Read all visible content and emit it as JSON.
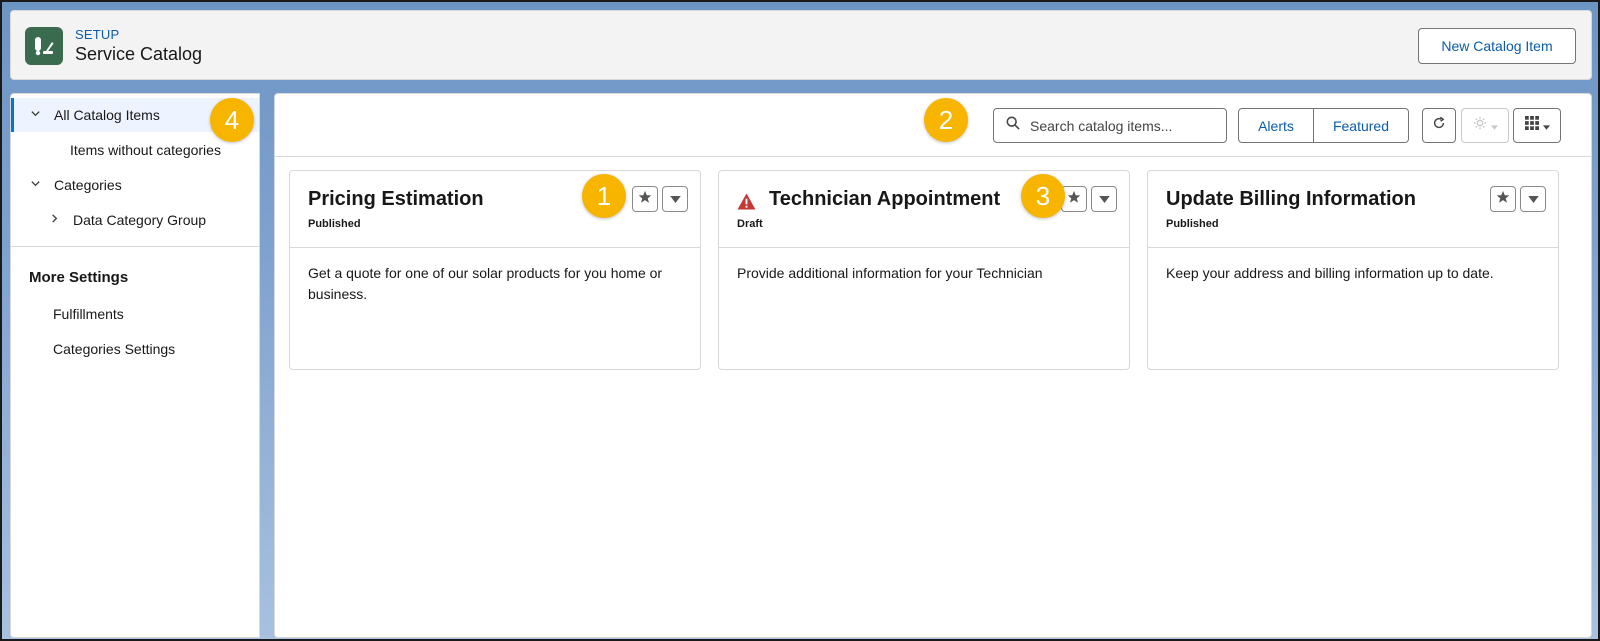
{
  "header": {
    "setup_label": "SETUP",
    "title": "Service Catalog",
    "new_button_label": "New Catalog Item",
    "app_icon": "service-catalog-icon"
  },
  "sidebar": {
    "items": [
      {
        "label": "All Catalog Items",
        "expanded": true,
        "active": true
      },
      {
        "label": "Items without categories"
      },
      {
        "label": "Categories",
        "expanded": true
      },
      {
        "label": "Data Category Group",
        "expanded": false
      }
    ],
    "more_settings_title": "More Settings",
    "settings_items": [
      {
        "label": "Fulfillments"
      },
      {
        "label": "Categories Settings"
      }
    ]
  },
  "toolbar": {
    "search_placeholder": "Search catalog items...",
    "alerts_label": "Alerts",
    "featured_label": "Featured",
    "icons": [
      "refresh-icon",
      "settings-icon",
      "grid-view-icon"
    ]
  },
  "cards": [
    {
      "title": "Pricing Estimation",
      "status": "Published",
      "description": "Get a quote for one of our solar products for you home or business.",
      "warning": false
    },
    {
      "title": "Technician Appointment",
      "status": "Draft",
      "description": "Provide additional information for your Technician",
      "warning": true
    },
    {
      "title": "Update Billing Information",
      "status": "Published",
      "description": "Keep your address and billing information up to date.",
      "warning": false
    }
  ],
  "callouts": [
    "1",
    "2",
    "3",
    "4"
  ],
  "colors": {
    "brand": "#0b5cab",
    "callout": "#f7b500",
    "warning": "#c23934",
    "app_icon_bg": "#3a6b4f"
  }
}
